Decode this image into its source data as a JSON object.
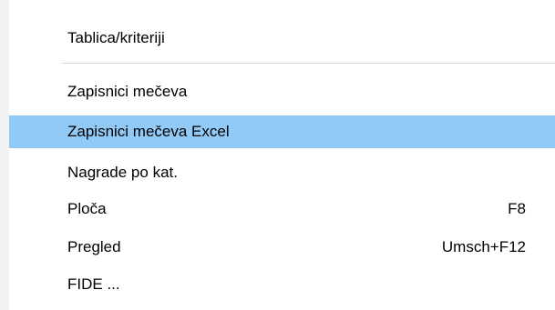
{
  "menu": {
    "items": [
      {
        "label": "Tablica/kriteriji",
        "shortcut": ""
      },
      {
        "label": "Zapisnici mečeva",
        "shortcut": ""
      },
      {
        "label": "Zapisnici mečeva Excel",
        "shortcut": ""
      },
      {
        "label": "Nagrade po kat.",
        "shortcut": ""
      },
      {
        "label": "Ploča",
        "shortcut": "F8"
      },
      {
        "label": "Pregled",
        "shortcut": "Umsch+F12"
      },
      {
        "label": "FIDE ...",
        "shortcut": ""
      }
    ],
    "highlight_color": "#91c9f7"
  }
}
